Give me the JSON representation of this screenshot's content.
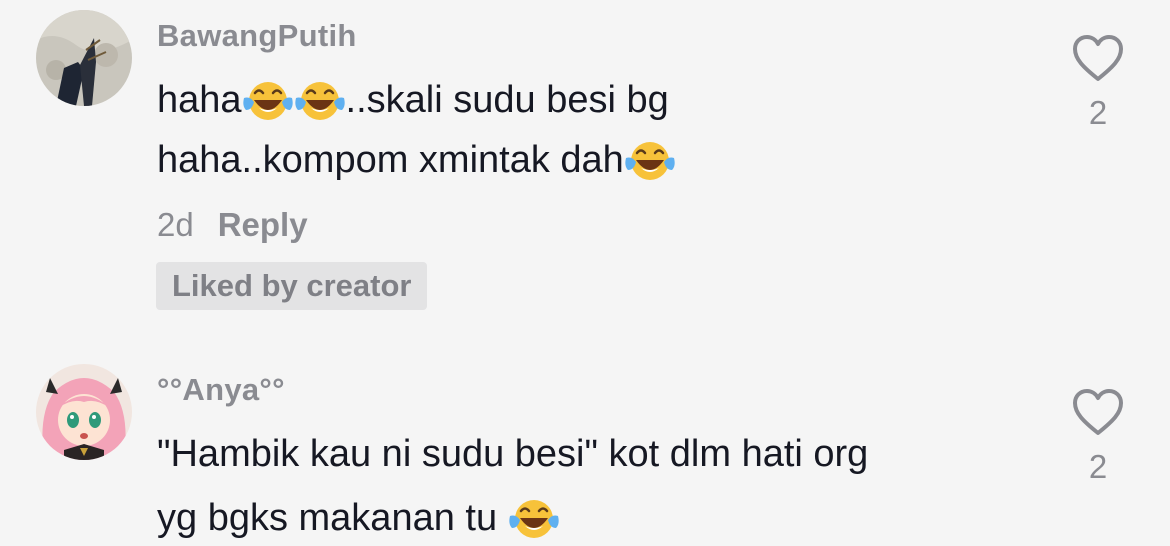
{
  "comments": [
    {
      "username": "BawangPutih",
      "avatar_icon": "beach-photo-avatar",
      "lines": [
        {
          "before": "haha",
          "middle": "..skali sudu besi bg"
        },
        {
          "before": "haha..kompom xmintak dah"
        }
      ],
      "emoji_icon": "face-with-tears-of-joy-icon",
      "age": "2d",
      "reply_label": "Reply",
      "badge": "Liked by creator",
      "like_count": "2"
    },
    {
      "username": "°°Anya°°",
      "avatar_icon": "anime-girl-avatar",
      "lines": [
        {
          "before": "\"Hambik kau ni sudu besi\" kot dlm hati org"
        },
        {
          "before": "yg bgks makanan tu "
        }
      ],
      "emoji_icon": "face-with-tears-of-joy-icon",
      "like_count": "2"
    }
  ],
  "colors": {
    "background": "#f5f5f5",
    "primary_text": "#161823",
    "secondary_text": "#8a8b91",
    "badge_bg": "#e3e3e4"
  }
}
